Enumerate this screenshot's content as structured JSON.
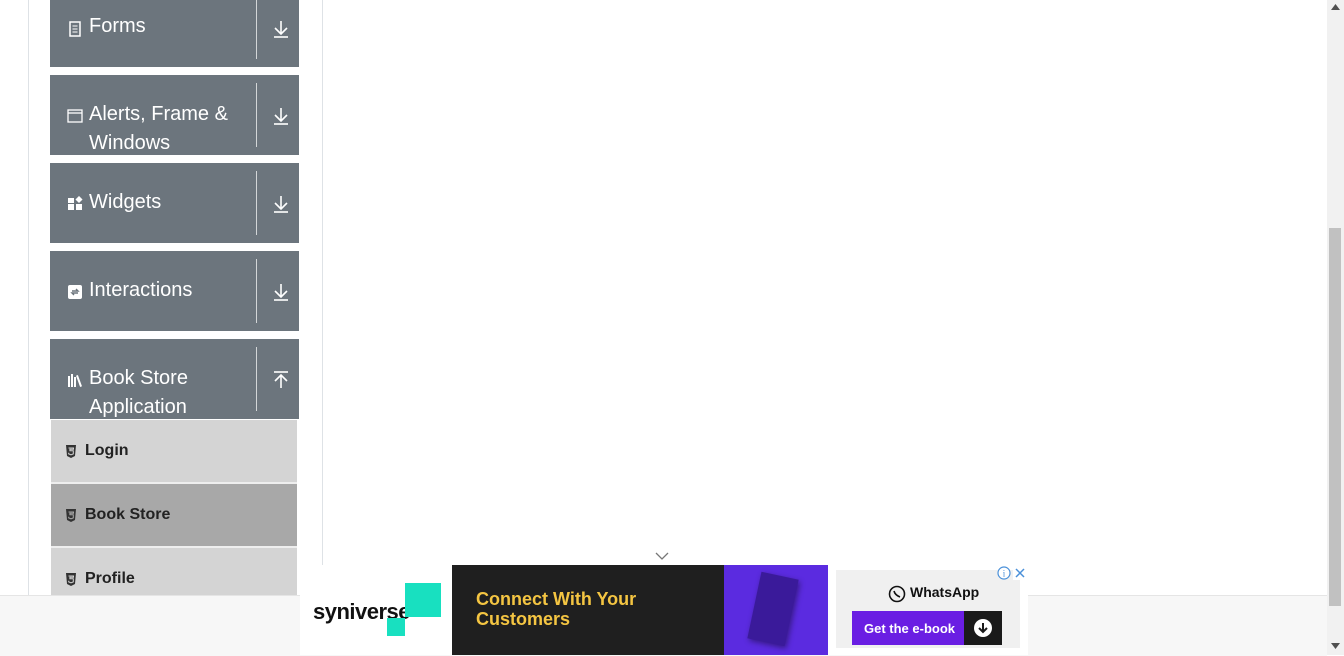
{
  "sidebar": {
    "groups": [
      {
        "label": "Forms",
        "icon": "document-icon",
        "expanded": false
      },
      {
        "label": "Alerts, Frame & Windows",
        "icon": "window-icon",
        "expanded": false
      },
      {
        "label": "Widgets",
        "icon": "widgets-icon",
        "expanded": false
      },
      {
        "label": "Interactions",
        "icon": "interactions-icon",
        "expanded": false
      },
      {
        "label": "Book Store Application",
        "icon": "books-icon",
        "expanded": true
      }
    ],
    "bookstore_items": [
      {
        "label": "Login",
        "active": false
      },
      {
        "label": "Book Store",
        "active": true
      },
      {
        "label": "Profile",
        "active": false
      }
    ]
  },
  "ad": {
    "brand": "syniverse",
    "headline": "Connect With Your Customers",
    "channel": "WhatsApp",
    "cta": "Get the e-book"
  },
  "colors": {
    "group_bg": "#6c757d",
    "item_bg": "#d4d4d4",
    "item_active_bg": "#a8a8a8",
    "ad_purple": "#6a1ee3",
    "ad_yellow": "#f4c542"
  }
}
